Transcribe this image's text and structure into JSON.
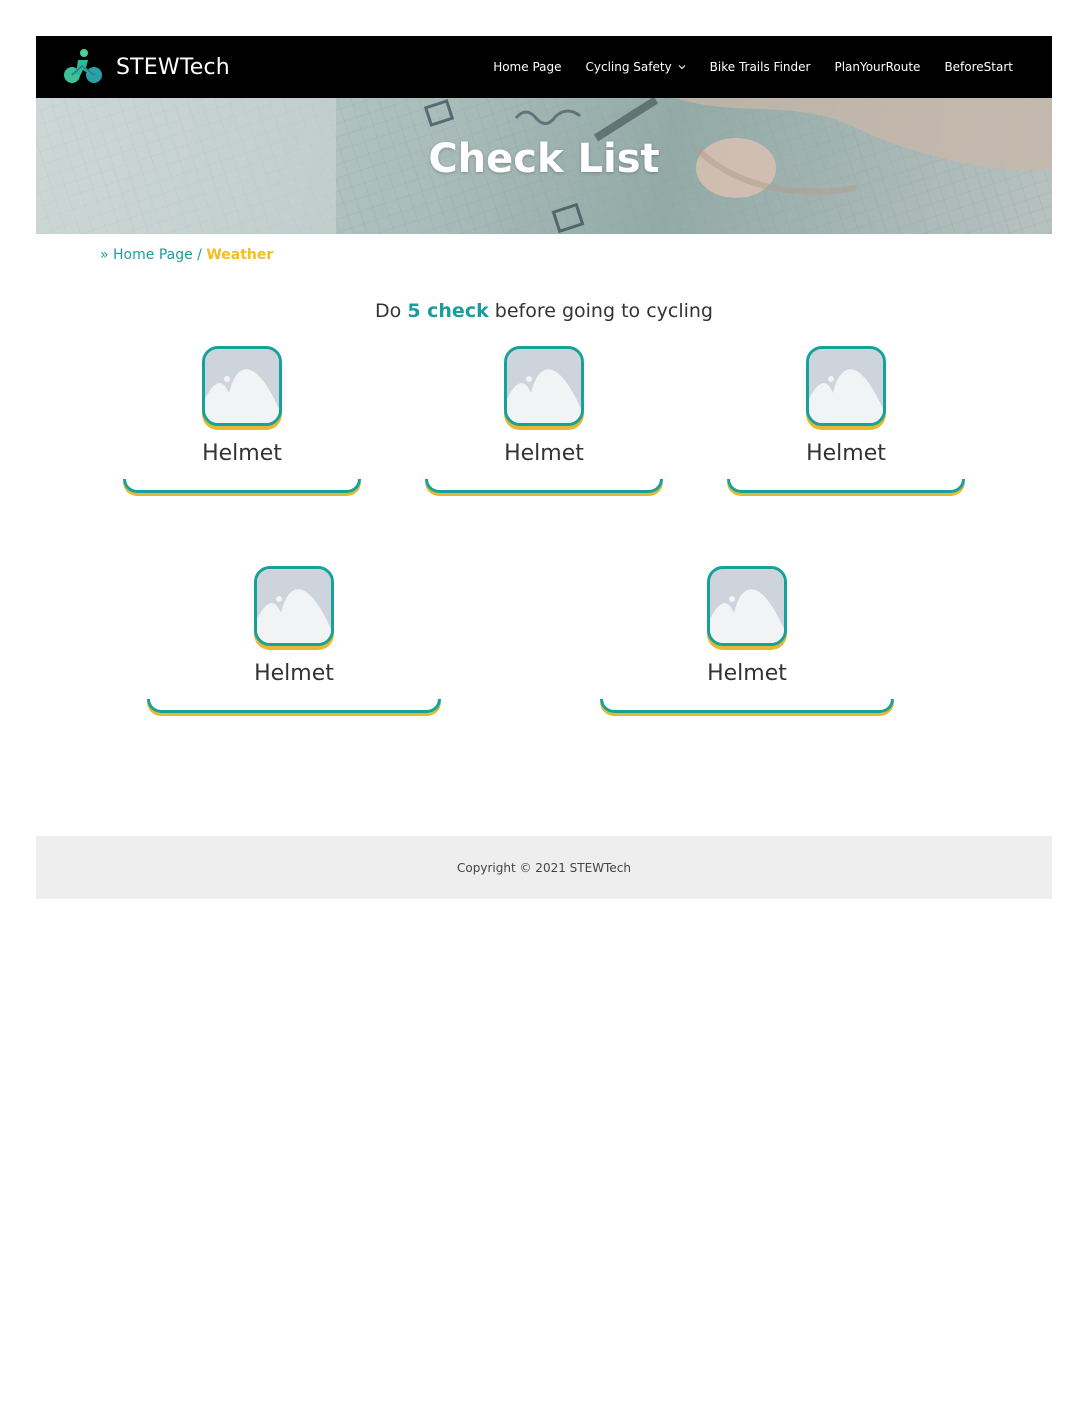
{
  "header": {
    "site_title": "STEWTech",
    "logo_icon": "cyclist-icon",
    "nav": [
      {
        "label": "Home Page"
      },
      {
        "label": "Cycling Safety",
        "has_dropdown": true
      },
      {
        "label": "Bike Trails Finder"
      },
      {
        "label": "PlanYourRoute"
      },
      {
        "label": "BeforeStart"
      }
    ]
  },
  "hero": {
    "title": "Check List"
  },
  "breadcrumb": {
    "prefix": "»",
    "home": "Home Page",
    "separator": "/",
    "current": "Weather"
  },
  "intro": {
    "before": "Do",
    "accent": "5 check",
    "after": "before going to cycling"
  },
  "cards": [
    {
      "label": "Helmet",
      "icon": "image-placeholder-icon"
    },
    {
      "label": "Helmet",
      "icon": "image-placeholder-icon"
    },
    {
      "label": "Helmet",
      "icon": "image-placeholder-icon"
    },
    {
      "label": "Helmet",
      "icon": "image-placeholder-icon"
    },
    {
      "label": "Helmet",
      "icon": "image-placeholder-icon"
    }
  ],
  "footer": {
    "copyright": "Copyright © 2021 STEWTech"
  },
  "colors": {
    "accent": "#1a9e9a",
    "highlight": "#f5bd1f",
    "header_bg": "#000000",
    "footer_bg": "#eeeeee"
  }
}
